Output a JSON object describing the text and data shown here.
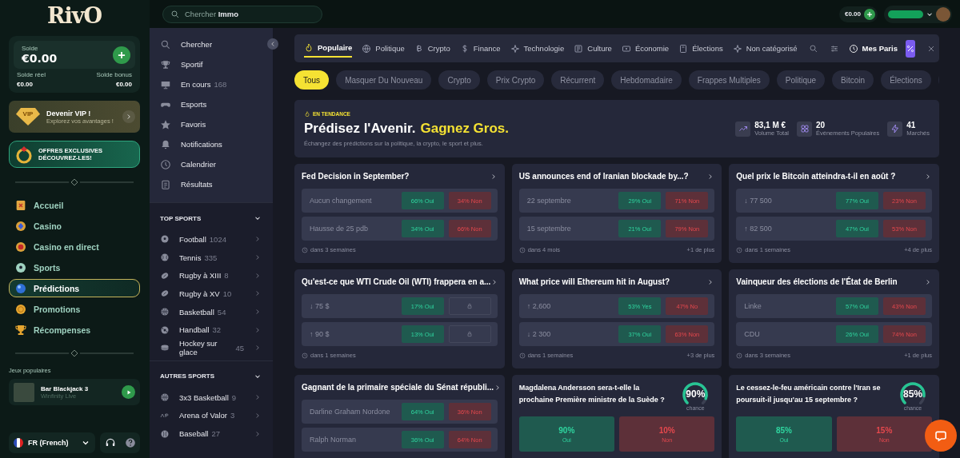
{
  "logo": "RivO",
  "top_bar": {
    "search": {
      "text": "Chercher **Immo**"
    },
    "balance": "€0.00"
  },
  "wallet": {
    "label": "Solde",
    "amount": "€0.00",
    "real_label": "Solde réel",
    "real_amount": "€0.00",
    "bonus_label": "Solde bonus",
    "bonus_amount": "€0.00"
  },
  "vip": {
    "badge": "VIP",
    "title": "Devenir VIP !",
    "subtitle": "Explorez vos avantages !"
  },
  "offers_banner": {
    "line_1": "OFFRES EXCLUSIVES",
    "line_2": "DÉCOUVREZ-LES!"
  },
  "main_nav": [
    {
      "label": "Accueil",
      "selected": false
    },
    {
      "label": "Casino",
      "selected": false
    },
    {
      "label": "Casino en direct",
      "selected": false
    },
    {
      "label": "Sports",
      "selected": false
    },
    {
      "label": "Prédictions",
      "selected": true
    },
    {
      "label": "Promotions",
      "selected": false
    },
    {
      "label": "Récompenses",
      "selected": false
    }
  ],
  "popular_games": {
    "heading": "Jeux populaires",
    "items": [
      {
        "title": "Bar Blackjack 3",
        "provider": "Winfinity Live"
      }
    ]
  },
  "language": {
    "label": "FR (French)"
  },
  "sports_menu": {
    "items": [
      {
        "label": "Chercher"
      },
      {
        "label": "Sportif"
      },
      {
        "label": "En cours",
        "count": "168"
      },
      {
        "label": "Esports"
      },
      {
        "label": "Favoris"
      },
      {
        "label": "Notifications"
      },
      {
        "label": "Calendrier"
      },
      {
        "label": "Résultats"
      }
    ],
    "sections": [
      {
        "title": "TOP SPORTS",
        "expanded": true,
        "items": [
          {
            "label": "Football",
            "count": "1024"
          },
          {
            "label": "Tennis",
            "count": "335"
          },
          {
            "label": "Rugby à XIII",
            "count": "8"
          },
          {
            "label": "Rugby à XV",
            "count": "10"
          },
          {
            "label": "Basketball",
            "count": "54"
          },
          {
            "label": "Handball",
            "count": "32"
          },
          {
            "label": "Hockey sur glace",
            "count": "45"
          }
        ]
      },
      {
        "title": "AUTRES SPORTS",
        "expanded": true,
        "items": [
          {
            "label": "3x3 Basketball",
            "count": "9"
          },
          {
            "label": "Arena of Valor",
            "count": "3"
          },
          {
            "label": "Baseball",
            "count": "27"
          }
        ]
      }
    ]
  },
  "category_bar": {
    "tabs": [
      {
        "label": "Populaire",
        "selected": true
      },
      {
        "label": "Politique",
        "selected": false
      },
      {
        "label": "Crypto",
        "selected": false
      },
      {
        "label": "Finance",
        "selected": false
      },
      {
        "label": "Technologie",
        "selected": false
      },
      {
        "label": "Culture",
        "selected": false
      },
      {
        "label": "Économie",
        "selected": false
      },
      {
        "label": "Élections",
        "selected": false
      },
      {
        "label": "Non catégorisé",
        "selected": false
      }
    ],
    "my_bets": "Mes Paris",
    "odds_toggle": {
      "on": true
    }
  },
  "filter_chips": [
    {
      "label": "Tous",
      "selected": true
    },
    {
      "label": "Masquer Du Nouveau",
      "selected": false
    },
    {
      "label": "Crypto",
      "selected": false
    },
    {
      "label": "Prix Crypto",
      "selected": false
    },
    {
      "label": "Récurrent",
      "selected": false
    },
    {
      "label": "Hebdomadaire",
      "selected": false
    },
    {
      "label": "Frappes Multiples",
      "selected": false
    },
    {
      "label": "Politique",
      "selected": false
    },
    {
      "label": "Bitcoin",
      "selected": false
    },
    {
      "label": "Élections",
      "selected": false
    }
  ],
  "hero": {
    "badge": "EN TENDANCE",
    "title": "Prédisez l'Avenir.",
    "title_highlight": "Gagnez Gros.",
    "subtitle": "Échangez des prédictions sur la politique, la crypto, le sport et plus.",
    "stats": [
      {
        "value": "83,1 M €",
        "label": "Volume Total"
      },
      {
        "value": "20",
        "label": "Événements Populaires"
      },
      {
        "value": "41",
        "label": "Marchés"
      }
    ]
  },
  "markets": [
    {
      "kind": "options",
      "title": "Fed Decision in September?",
      "time": "dans 3 semaines",
      "options": [
        {
          "label": "Aucun changement",
          "yes": "66% Oui",
          "no": "34% Non",
          "locked": false
        },
        {
          "label": "Hausse de 25 pdb",
          "yes": "34% Oui",
          "no": "66% Non",
          "locked": false
        }
      ]
    },
    {
      "kind": "options",
      "title": "US announces end of Iranian blockade by...?",
      "time": "dans 4 mois",
      "more": "+1 de plus",
      "options": [
        {
          "label": "22 septembre",
          "yes": "29% Oui",
          "no": "71% Non",
          "locked": false
        },
        {
          "label": "15 septembre",
          "yes": "21% Oui",
          "no": "79% Non",
          "locked": false
        }
      ]
    },
    {
      "kind": "options",
      "title": "Quel prix le Bitcoin atteindra-t-il en août ?",
      "time": "dans 1 semaines",
      "more": "+4 de plus",
      "options": [
        {
          "label": "↓ 77 500",
          "yes": "77% Oui",
          "no": "23% Non",
          "locked": false
        },
        {
          "label": "↑ 82 500",
          "yes": "47% Oui",
          "no": "53% Non",
          "locked": false
        }
      ]
    },
    {
      "kind": "options",
      "title": "Qu'est-ce que WTI Crude Oil (WTI) frappera en a...",
      "time": "dans 1 semaines",
      "options": [
        {
          "label": "↓ 75 $",
          "yes": "17% Oui",
          "locked": true
        },
        {
          "label": "↑ 90 $",
          "yes": "13% Oui",
          "locked": true
        }
      ]
    },
    {
      "kind": "options",
      "title": "What price will Ethereum hit in August?",
      "time": "dans 1 semaines",
      "more": "+3 de plus",
      "options": [
        {
          "label": "↑ 2,600",
          "yes": "53% Yes",
          "no": "47% No",
          "locked": false
        },
        {
          "label": "↓ 2 300",
          "yes": "37% Oui",
          "no": "63% Non",
          "locked": false
        }
      ]
    },
    {
      "kind": "options",
      "title": "Vainqueur des élections de l'État de Berlin",
      "time": "dans 3 semaines",
      "more": "+1 de plus",
      "options": [
        {
          "label": "Linke",
          "yes": "57% Oui",
          "no": "43% Non",
          "locked": false
        },
        {
          "label": "CDU",
          "yes": "26% Oui",
          "no": "74% Non",
          "locked": false
        }
      ]
    },
    {
      "kind": "options",
      "title": "Gagnant de la primaire spéciale du Sénat républi...",
      "options": [
        {
          "label": "Darline Graham Nordone",
          "yes": "64% Oui",
          "no": "36% Non",
          "locked": false
        },
        {
          "label": "Ralph Norman",
          "yes": "36% Oui",
          "no": "64% Non",
          "locked": false
        }
      ]
    },
    {
      "kind": "binary",
      "title": "Magdalena Andersson sera-t-elle la prochaine Première ministre de la Suède ?",
      "chance": "90%",
      "chance_label": "chance",
      "level": 0.9,
      "yes_value": "90%",
      "yes_label": "Oui",
      "no_value": "10%",
      "no_label": "Non"
    },
    {
      "kind": "binary",
      "title": "Le cessez-le-feu américain contre l'Iran se poursuit-il jusqu'au 15 septembre ?",
      "chance": "85%",
      "chance_label": "chance",
      "level": 0.85,
      "yes_value": "85%",
      "yes_label": "Oui",
      "no_value": "15%",
      "no_label": "Non"
    }
  ]
}
